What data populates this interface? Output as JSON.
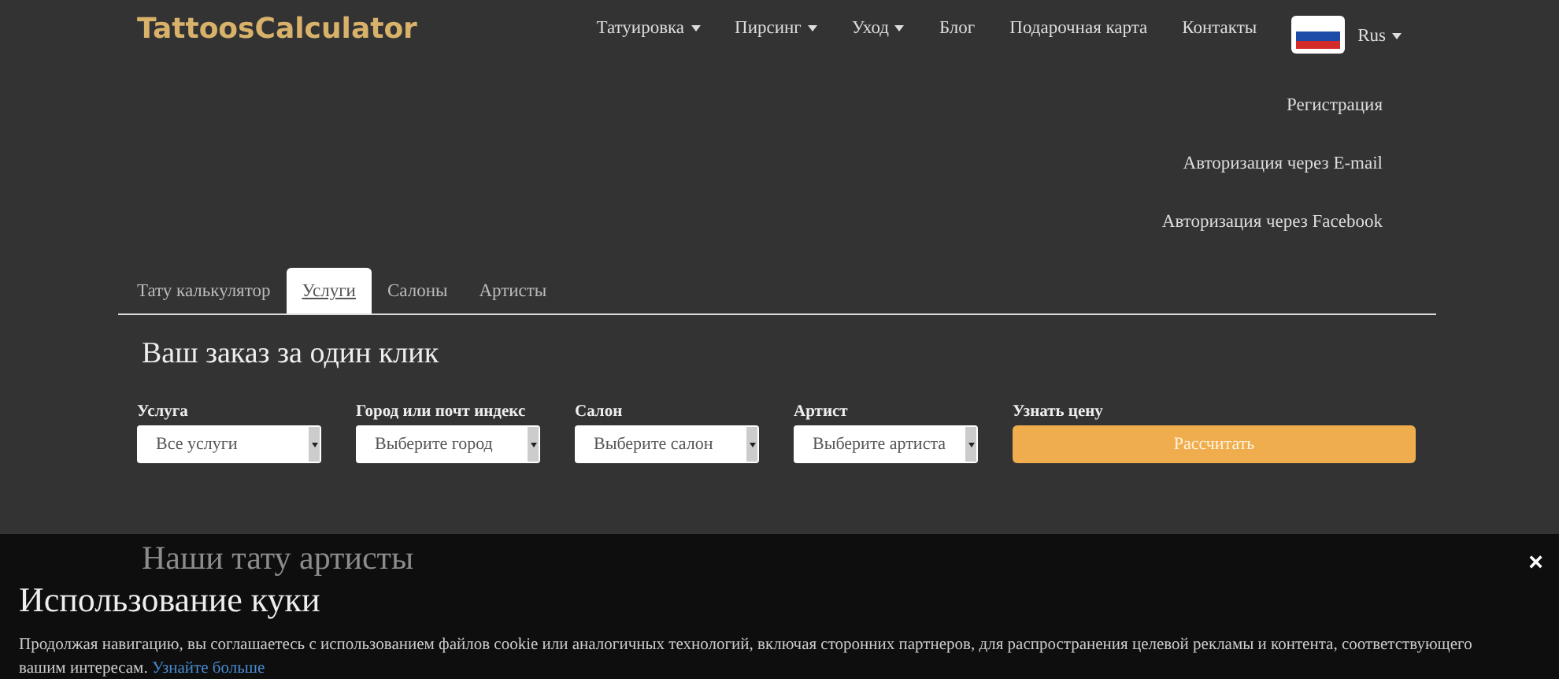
{
  "logo": "TattoosCalculator",
  "nav": [
    {
      "label": "Татуировка",
      "dropdown": true
    },
    {
      "label": "Пирсинг",
      "dropdown": true
    },
    {
      "label": "Уход",
      "dropdown": true
    },
    {
      "label": "Блог",
      "dropdown": false
    },
    {
      "label": "Подарочная карта",
      "dropdown": false
    },
    {
      "label": "Контакты",
      "dropdown": false
    }
  ],
  "language": {
    "label": "Rus"
  },
  "auth_links": [
    "Регистрация",
    "Авторизация через E-mail",
    "Авторизация через Facebook"
  ],
  "tabs": [
    {
      "label": "Тату калькулятор",
      "selected": false
    },
    {
      "label": "Услуги",
      "selected": true
    },
    {
      "label": "Салоны",
      "selected": false
    },
    {
      "label": "Артисты",
      "selected": false
    }
  ],
  "order": {
    "title": "Ваш заказ за один клик",
    "fields": [
      {
        "label": "Услуга",
        "value": "Все услуги"
      },
      {
        "label": "Город или почт индекс",
        "value": "Выберите город"
      },
      {
        "label": "Салон",
        "value": "Выберите салон"
      },
      {
        "label": "Артист",
        "value": "Выберите артиста"
      }
    ],
    "price": {
      "label": "Узнать цену",
      "button": "Рассчитать"
    }
  },
  "artists_section": {
    "title": "Наши тату артисты"
  },
  "cookie_notice": {
    "title": "Использование куки",
    "text": "Продолжая навигацию, вы соглашаетесь с использованием файлов cookie или аналогичных технологий, включая сторонних партнеров, для распространения целевой рекламы и контента, соответствующего вашим интересам.",
    "link": "Узнайте больше",
    "close": "×"
  }
}
